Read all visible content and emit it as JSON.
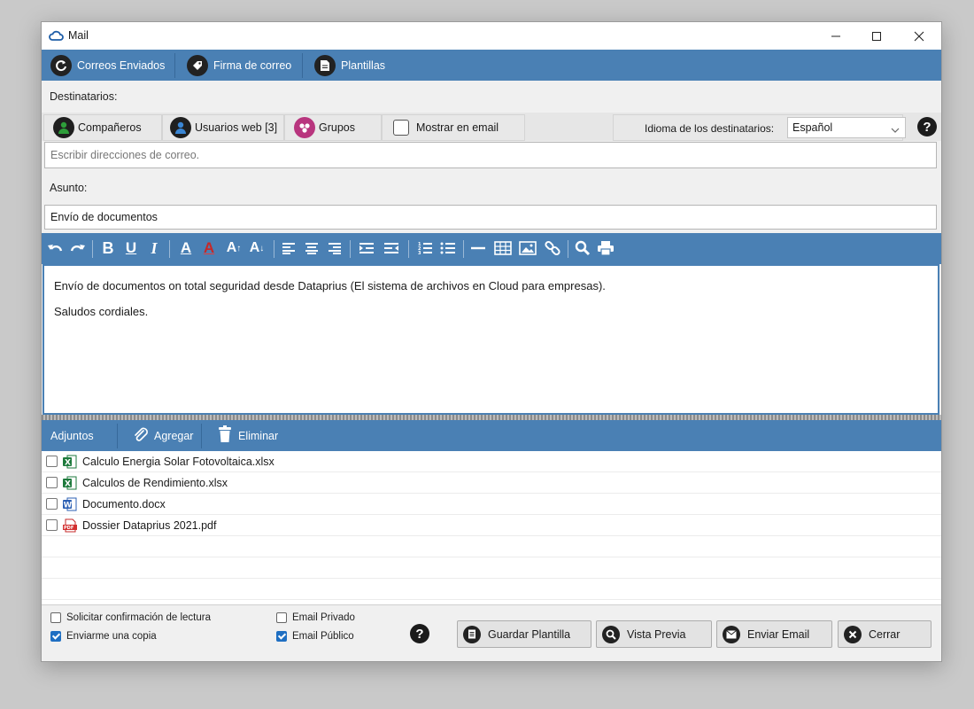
{
  "window": {
    "title": "Mail",
    "icon": "cloud-icon"
  },
  "topbar": {
    "items": [
      {
        "label": "Correos Enviados",
        "icon": "refresh-icon"
      },
      {
        "label": "Firma de correo",
        "icon": "tag-icon"
      },
      {
        "label": "Plantillas",
        "icon": "document-icon"
      }
    ]
  },
  "recipients": {
    "label": "Destinatarios:",
    "buttons": [
      {
        "label": "Compañeros",
        "icon": "user-icon",
        "color": "#2e9e3a"
      },
      {
        "label": "Usuarios web [3]",
        "icon": "user-icon",
        "color": "#2f6fb0"
      },
      {
        "label": "Grupos",
        "icon": "group-icon",
        "color": "#b8357e"
      }
    ],
    "show_in_email": {
      "label": "Mostrar en email",
      "checked": false
    },
    "language_label": "Idioma de los destinatarios:",
    "language_value": "Español",
    "address_placeholder": "Escribir direcciones de correo."
  },
  "subject": {
    "label": "Asunto:",
    "value": "Envío de documentos"
  },
  "editor": {
    "lines": [
      "Envío de documentos on total seguridad desde Dataprius (El sistema de archivos en Cloud para empresas).",
      "Saludos cordiales."
    ]
  },
  "attachments": {
    "label": "Adjuntos",
    "add_label": "Agregar",
    "delete_label": "Eliminar",
    "files": [
      {
        "name": "Calculo Energia Solar Fotovoltaica.xlsx",
        "type": "excel"
      },
      {
        "name": "Calculos de Rendimiento.xlsx",
        "type": "excel"
      },
      {
        "name": "Documento.docx",
        "type": "word"
      },
      {
        "name": "Dossier Dataprius 2021.pdf",
        "type": "pdf"
      }
    ]
  },
  "options": {
    "read_confirmation": {
      "label": "Solicitar confirmación de lectura",
      "checked": false
    },
    "send_copy": {
      "label": "Enviarme una copia",
      "checked": true
    },
    "private_email": {
      "label": "Email Privado",
      "checked": false
    },
    "public_email": {
      "label": "Email Público",
      "checked": true
    }
  },
  "buttons": {
    "save_template": "Guardar Plantilla",
    "preview": "Vista Previa",
    "send": "Enviar Email",
    "close": "Cerrar"
  },
  "colors": {
    "accent": "#4a80b4",
    "checkbox_checked": "#1f6fc2"
  }
}
